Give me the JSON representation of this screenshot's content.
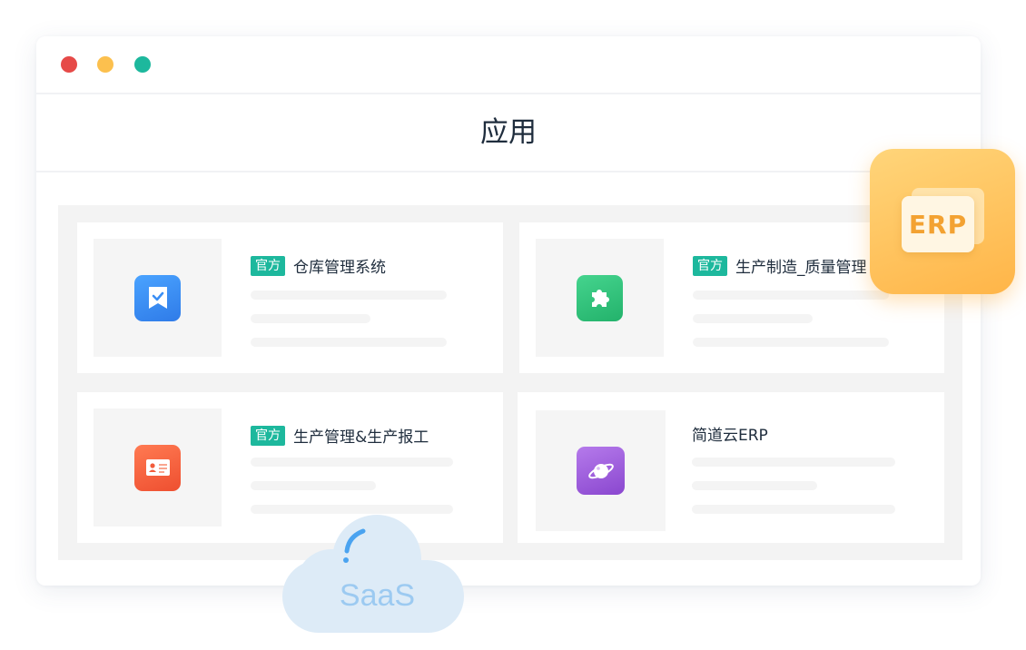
{
  "window": {
    "title": "应用"
  },
  "apps": [
    {
      "name": "仓库管理系统",
      "badge": "官方",
      "icon": "bookmark-check-icon",
      "color": "#3b8ff5"
    },
    {
      "name": "生产制造_质量管理",
      "badge": "官方",
      "icon": "puzzle-icon",
      "color": "#2fc07a"
    },
    {
      "name": "生产管理&生产报工",
      "badge": "官方",
      "icon": "id-card-icon",
      "color": "#f25c3c"
    },
    {
      "name": "简道云ERP",
      "badge": "",
      "icon": "planet-icon",
      "color": "#9d5bd8"
    }
  ],
  "erp_badge": {
    "label": "ERP",
    "color": "#ffb548"
  },
  "saas_cloud": {
    "label": "SaaS",
    "color": "#9ccaf1"
  },
  "colors": {
    "official_badge": "#1db89d",
    "dot_red": "#e64a48",
    "dot_yellow": "#fcc04e",
    "dot_green": "#1db89d"
  }
}
